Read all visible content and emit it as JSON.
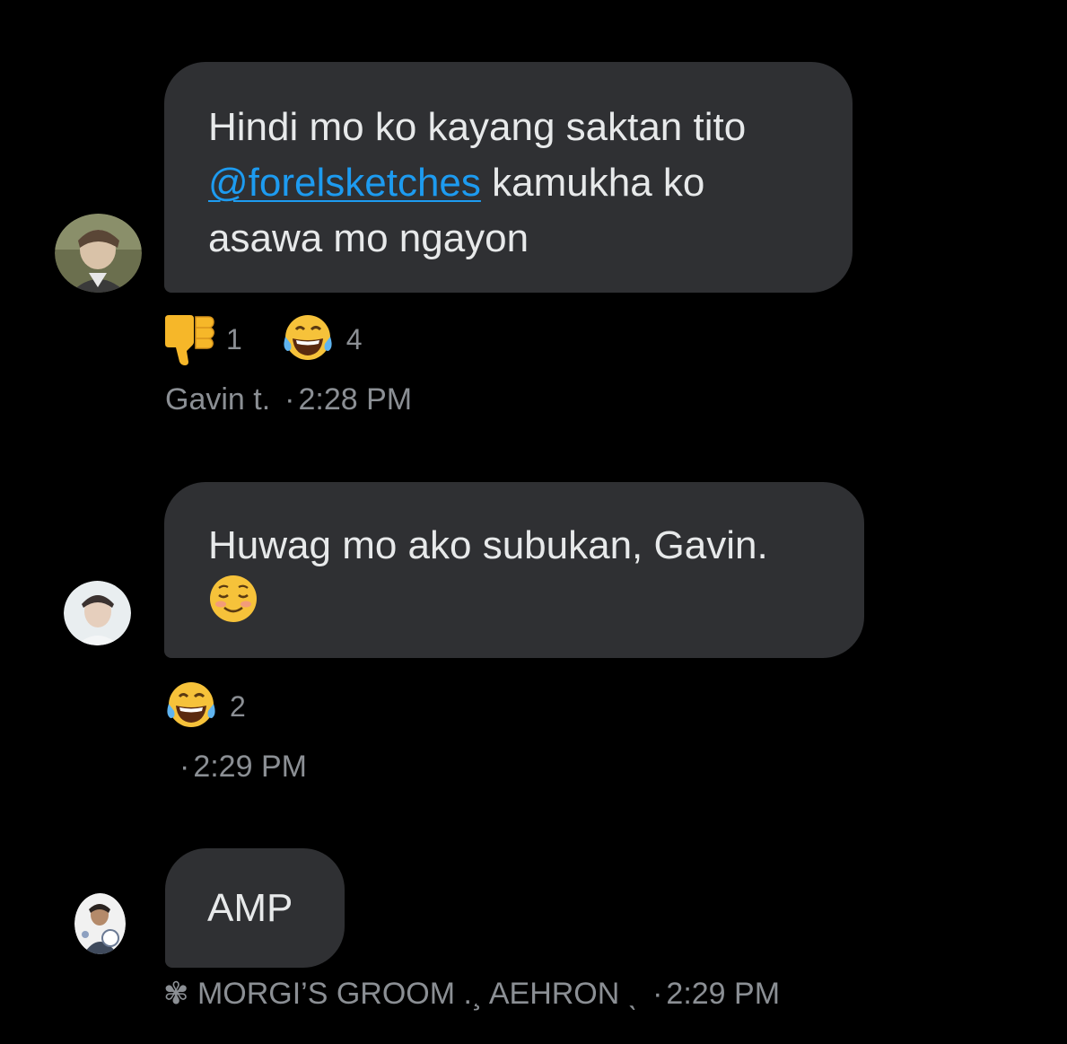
{
  "messages": [
    {
      "text_before": "Hindi mo ko kayang saktan tito",
      "mention": "@forelsketches",
      "text_after": " kamukha ko asawa mo ngayon",
      "reactions": [
        {
          "emoji": "thumbs-down-icon",
          "count": "1"
        },
        {
          "emoji": "tears-of-joy-icon",
          "count": "4"
        }
      ],
      "sender": "Gavin t.",
      "separator": "·",
      "time": "2:28 PM"
    },
    {
      "text": "Huwag mo ako subukan, Gavin.",
      "emoji": "smiling-face-icon",
      "reactions": [
        {
          "emoji": "tears-of-joy-icon",
          "count": "2"
        }
      ],
      "sender": "",
      "separator": "·",
      "time": "2:29 PM"
    },
    {
      "text": "AMP",
      "sender_flower": "✾",
      "sender": "MORGI’S GROOM .¸ AEHRON ˎ",
      "separator": "·",
      "time": "2:29 PM"
    }
  ],
  "colors": {
    "background": "#000000",
    "bubble": "#2f3033",
    "text": "#e7e9ea",
    "mention": "#1d9bf0",
    "meta": "#8b8f94"
  }
}
